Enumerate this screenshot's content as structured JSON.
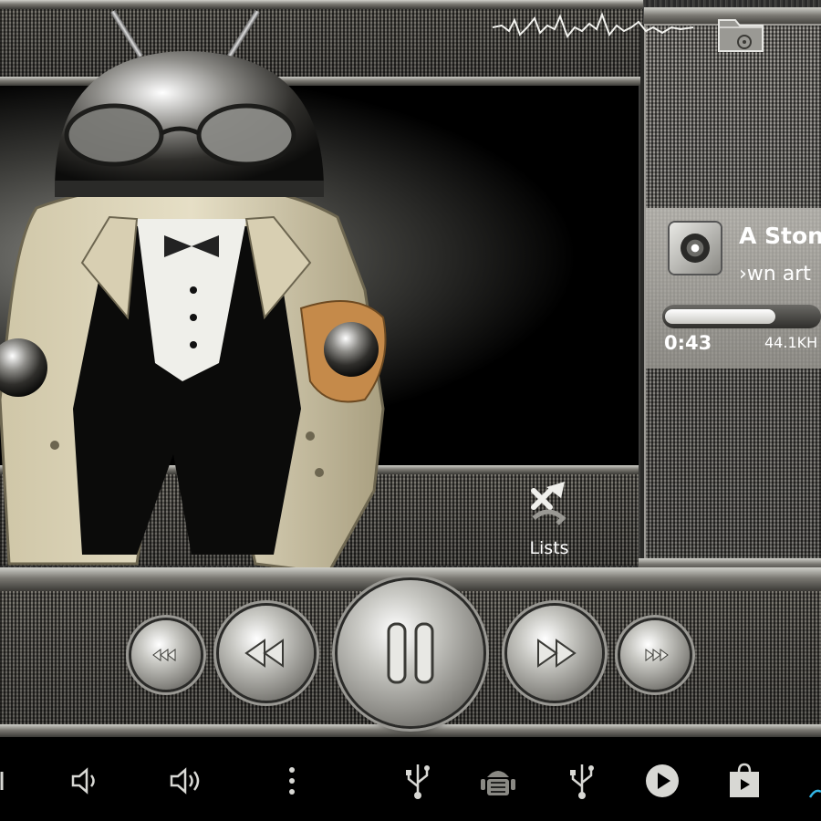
{
  "track": {
    "title_visible": "A Ston",
    "artist_visible": "›wn art",
    "elapsed": "0:43",
    "sample_rate_visible": "44.1KH",
    "progress_fraction": 0.72
  },
  "lists_button": {
    "label": "Lists",
    "icon": "lists-shuffle-icon"
  },
  "transport": {
    "buttons": [
      "previous-track-icon",
      "rewind-icon",
      "pause-icon",
      "fast-forward-icon",
      "next-track-icon"
    ]
  },
  "system_nav": {
    "icons": [
      "back-icon",
      "volume-down-icon",
      "volume-up-icon",
      "overflow-menu-icon",
      "usb-icon",
      "android-debug-icon",
      "usb-icon",
      "play-store-icon",
      "shopping-bag-icon"
    ]
  },
  "colors": {
    "text": "#ffffff",
    "metal_light": "#d8d8d4",
    "metal_dark": "#2a2a28",
    "screen_bg": "#000000"
  }
}
